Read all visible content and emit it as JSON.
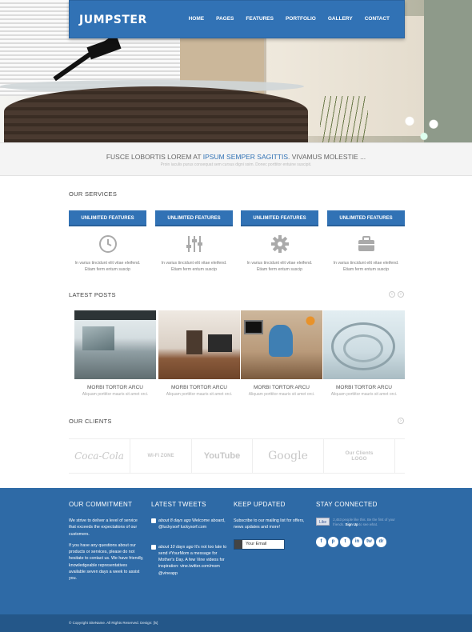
{
  "nav": {
    "logo": "JUMPSTER",
    "items": [
      "HOME",
      "PAGES",
      "FEATURES",
      "PORTFOLIO",
      "GALLERY",
      "CONTACT"
    ]
  },
  "tagline": {
    "before": "FUSCE LOBORTIS LOREM AT ",
    "highlight": "IPSUM SEMPER SAGITTIS",
    "after": ". VIVAMUS MOLESTIE ...",
    "sub": "Proin iaculis purus consequat sem cursus digni ssim. Donec porttitor entuine suscipit."
  },
  "services": {
    "title": "OUR SERVICES",
    "items": [
      {
        "label": "UNLIMITED FEATURES",
        "icon": "clock-icon",
        "line1": "In varius tincidunt elit vitae eleifend.",
        "line2": "Etiam ferm entum suscip"
      },
      {
        "label": "UNLIMITED FEATURES",
        "icon": "sliders-icon",
        "line1": "In varius tincidunt elit vitae eleifend.",
        "line2": "Etiam ferm entum suscip"
      },
      {
        "label": "UNLIMITED FEATURES",
        "icon": "gear-icon",
        "line1": "In varius tincidunt elit vitae eleifend.",
        "line2": "Etiam ferm entum suscip"
      },
      {
        "label": "UNLIMITED FEATURES",
        "icon": "briefcase-icon",
        "line1": "In varius tincidunt elit vitae eleifend.",
        "line2": "Etiam ferm entum suscip"
      }
    ]
  },
  "posts": {
    "title": "LATEST POSTS",
    "prev": "‹",
    "next": "›",
    "items": [
      {
        "title": "MORBI TORTOR ARCU",
        "desc": "Aliquam porttitor mauris sit amet orci."
      },
      {
        "title": "MORBI TORTOR ARCU",
        "desc": "Aliquam porttitor mauris sit amet orci."
      },
      {
        "title": "MORBI TORTOR ARCU",
        "desc": "Aliquam porttitor mauris sit amet orci."
      },
      {
        "title": "MORBI TORTOR ARCU",
        "desc": "Aliquam porttitor mauris sit amet orci."
      }
    ]
  },
  "clients": {
    "title": "OUR CLIENTS",
    "next": "›",
    "logos": [
      "Coca-Cola",
      "Wi-Fi ZONE",
      "YouTube",
      "Google",
      "Our Clients LOGO"
    ]
  },
  "footer": {
    "commitment": {
      "title": "OUR COMMITMENT",
      "p1": "We strive to deliver a level of service that exceeds the expectations of our customers.",
      "p2": "If you have any questions about our products or services, please do not hesitate to contact us. We have friendly, knowledgeable representatives available seven days a week to assist you."
    },
    "tweets": {
      "title": "LATEST TWEETS",
      "items": [
        {
          "time": "about 8 days ago",
          "text": " Welcome aboard, @luckysorf luckysorf.com"
        },
        {
          "time": "about 10 days ago",
          "text": " It's not too late to send #YourMom a message for Mother's Day. A few Vine videos for inspiration: vine.twitter.com/mom @vineapp"
        }
      ]
    },
    "updated": {
      "title": "KEEP UPDATED",
      "text": "Subscribe to our mailing list for offers, news updates and more!",
      "email_label": "Your Email"
    },
    "connected": {
      "title": "STAY CONNECTED",
      "like": "Like",
      "like_text": "2,453 people like this. Be the first of your friends.",
      "signup": "Sign Up",
      "like_text2": " to see what.",
      "icons": [
        "f",
        "p",
        "t",
        "in",
        "tw",
        "dr"
      ]
    }
  },
  "copyright": "© Copyright SiteName. All Rights Reserved. Design: [ls]",
  "colors": {
    "brand": "#3172b5",
    "footer": "#2e6aa6"
  }
}
